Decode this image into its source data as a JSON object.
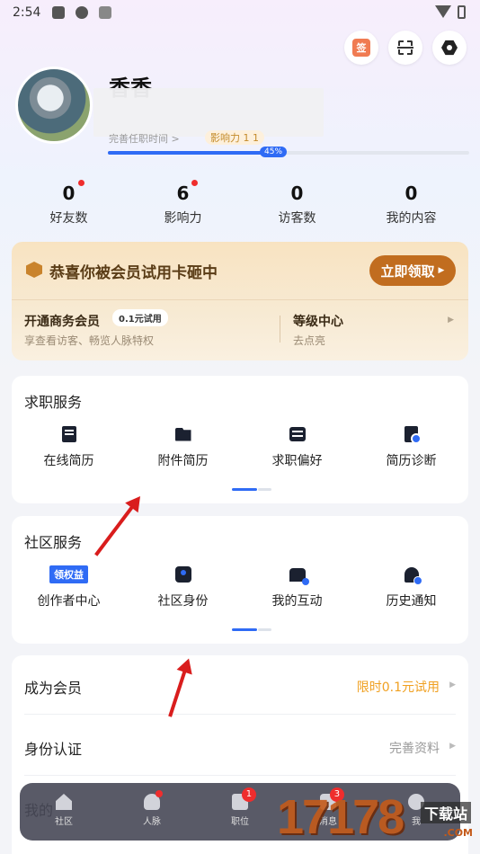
{
  "status": {
    "time": "2:54"
  },
  "profile": {
    "name": "香香",
    "subtitle_partial": "完善任职时间 >",
    "influence_tag": "影响力 1 1",
    "progress_label": "45%",
    "progress": 0.45
  },
  "stats": [
    {
      "value": "0",
      "label": "好友数",
      "dot": true
    },
    {
      "value": "6",
      "label": "影响力",
      "dot": true
    },
    {
      "value": "0",
      "label": "访客数",
      "dot": false
    },
    {
      "value": "0",
      "label": "我的内容",
      "dot": false
    }
  ],
  "member": {
    "title": "恭喜你被会员试用卡砸中",
    "claim_button": "立即领取",
    "business_title": "开通商务会员",
    "trial_tag": "0.1元试用",
    "business_desc": "享查看访客、畅览人脉特权",
    "level_title": "等级中心",
    "level_desc": "去点亮"
  },
  "job_services": {
    "title": "求职服务",
    "items": [
      {
        "label": "在线简历",
        "icon": "resume-icon"
      },
      {
        "label": "附件简历",
        "icon": "folder-icon"
      },
      {
        "label": "求职偏好",
        "icon": "sliders-icon"
      },
      {
        "label": "简历诊断",
        "icon": "diagnosis-icon"
      }
    ]
  },
  "community_services": {
    "title": "社区服务",
    "badge": "领权益",
    "items": [
      {
        "label": "创作者中心",
        "icon": "creator-icon"
      },
      {
        "label": "社区身份",
        "icon": "id-card-icon"
      },
      {
        "label": "我的互动",
        "icon": "chat-icon"
      },
      {
        "label": "历史通知",
        "icon": "bell-icon"
      }
    ]
  },
  "list": [
    {
      "label": "成为会员",
      "value": "限时0.1元试用",
      "value_color": "#f0a020"
    },
    {
      "label": "身份认证",
      "value": "完善资料",
      "value_color": "#9a9a9a"
    },
    {
      "label": "我的",
      "value": "",
      "value_color": "#9a9a9a"
    }
  ],
  "tabbar": [
    {
      "label": "社区",
      "badge": ""
    },
    {
      "label": "人脉",
      "badge": ""
    },
    {
      "label": "职位",
      "badge": "1"
    },
    {
      "label": "消息",
      "badge": "3"
    },
    {
      "label": "我",
      "badge": ""
    }
  ],
  "watermark": {
    "big": "17178",
    "small": "下载站",
    "sub": ".COM"
  },
  "colors": {
    "accent": "#2f6bf5",
    "member_button": "#c16d1f",
    "badge": "#ef2d2d"
  }
}
